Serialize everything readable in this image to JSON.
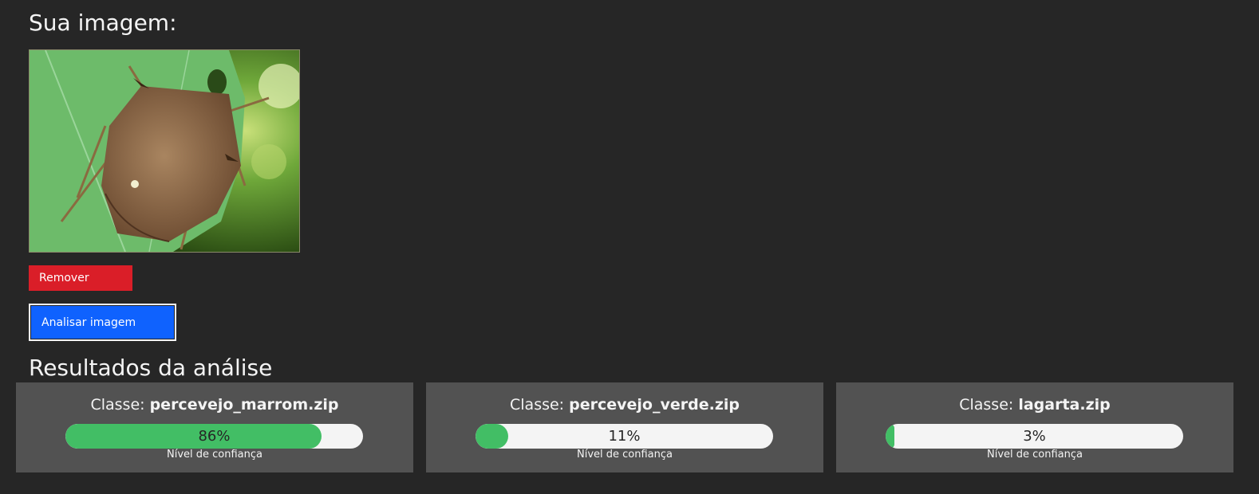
{
  "upload": {
    "title": "Sua imagem:",
    "image_alt": "stink bug on a green leaf",
    "remove_label": "Remover",
    "analyze_label": "Analisar imagem"
  },
  "results": {
    "title": "Resultados da análise",
    "class_prefix": "Classe:",
    "caption": "Nível de confiança",
    "items": [
      {
        "class_name": "percevejo_marrom.zip",
        "confidence_text": "86%",
        "confidence": 86
      },
      {
        "class_name": "percevejo_verde.zip",
        "confidence_text": "11%",
        "confidence": 11
      },
      {
        "class_name": "lagarta.zip",
        "confidence_text": "3%",
        "confidence": 3
      }
    ]
  },
  "colors": {
    "background": "#262626",
    "card": "#525252",
    "remove": "#da1e28",
    "analyze": "#0f62fe",
    "bar_fill": "#42be65",
    "bar_track": "#f4f4f4"
  }
}
